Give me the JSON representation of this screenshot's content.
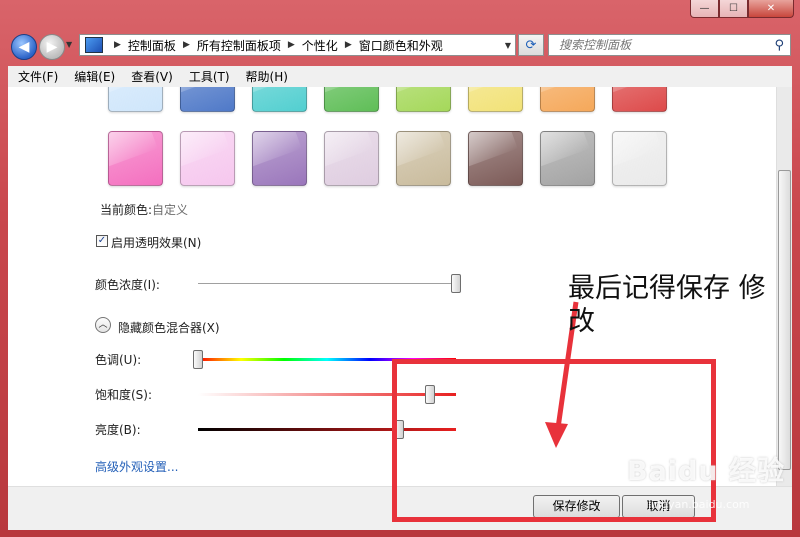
{
  "window": {
    "caption_buttons": {
      "minimize": "—",
      "maximize": "☐",
      "close": "✕"
    }
  },
  "address_bar": {
    "breadcrumbs": [
      "控制面板",
      "所有控制面板项",
      "个性化",
      "窗口颜色和外观"
    ]
  },
  "search": {
    "placeholder": "搜索控制面板"
  },
  "menu": [
    "文件(F)",
    "编辑(E)",
    "查看(V)",
    "工具(T)",
    "帮助(H)"
  ],
  "swatches": {
    "row1_colors": [
      "#cfe6fb",
      "#4f79c8",
      "#52cfd0",
      "#5fbe57",
      "#a5d85a",
      "#f2e277",
      "#f5a85a",
      "#dd4a4a"
    ],
    "row2_colors": [
      "#f46fbf",
      "#f6c7ee",
      "#9a76bb",
      "#dfcde0",
      "#c9bb9c",
      "#7c5a57",
      "#a3a3a3",
      "#eaeaea"
    ]
  },
  "current_color": {
    "label": "当前颜色:",
    "value": "自定义"
  },
  "transparency": {
    "label": "启用透明效果(N)",
    "checked": true,
    "check_glyph": "✓"
  },
  "intensity": {
    "label": "颜色浓度(I):",
    "level": 1.0
  },
  "mixer": {
    "toggle_label": "隐藏颜色混合器(X)",
    "toggle_glyph": "︿",
    "hue": {
      "label": "色调(U):",
      "level": 0.0
    },
    "saturation": {
      "label": "饱和度(S):",
      "level": 0.9
    },
    "brightness": {
      "label": "亮度(B):",
      "level": 0.78
    }
  },
  "advanced_link": "高级外观设置...",
  "buttons": {
    "save": "保存修改",
    "cancel": "取消"
  },
  "annotation": {
    "text": "最后记得保存 修改"
  },
  "watermark": {
    "text": "Baidu 经验",
    "sub": "jingyan.baidu.com"
  }
}
